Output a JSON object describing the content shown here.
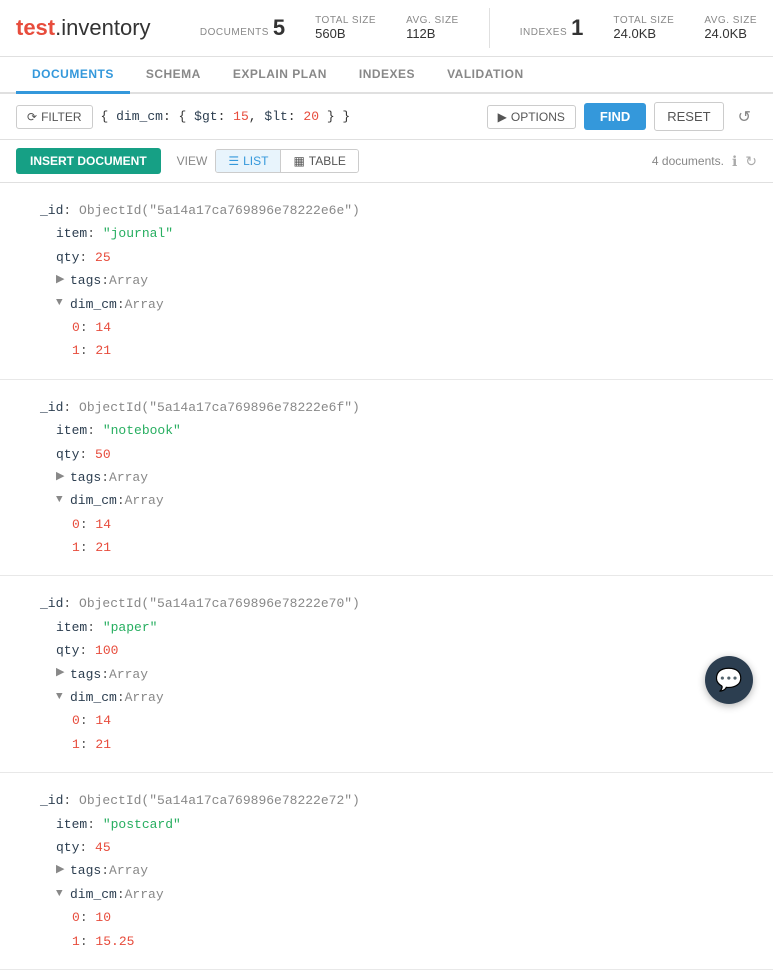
{
  "header": {
    "logo_test": "test",
    "logo_dot": ".",
    "logo_inventory": "inventory",
    "documents_label": "DOCUMENTS",
    "documents_count": "5",
    "total_size_label": "TOTAL SIZE",
    "documents_total_size": "560B",
    "avg_size_label": "AVG. SIZE",
    "documents_avg_size": "112B",
    "indexes_label": "INDEXES",
    "indexes_count": "1",
    "indexes_total_size": "24.0KB",
    "indexes_avg_size": "24.0KB"
  },
  "tabs": [
    {
      "id": "documents",
      "label": "DOCUMENTS",
      "active": true
    },
    {
      "id": "schema",
      "label": "SCHEMA",
      "active": false
    },
    {
      "id": "explain-plan",
      "label": "EXPLAIN PLAN",
      "active": false
    },
    {
      "id": "indexes",
      "label": "INDEXES",
      "active": false
    },
    {
      "id": "validation",
      "label": "VALIDATION",
      "active": false
    }
  ],
  "filter": {
    "button_label": "FILTER",
    "query": "{ dim_cm: { $gt: 15, $lt: 20 } }",
    "options_label": "OPTIONS",
    "find_label": "FIND",
    "reset_label": "RESET"
  },
  "action_bar": {
    "insert_label": "INSERT DOCUMENT",
    "view_label": "VIEW",
    "list_label": "LIST",
    "table_label": "TABLE",
    "doc_count": "4 documents."
  },
  "documents": [
    {
      "id": "5a14a17ca769896e78222e6e",
      "item": "journal",
      "qty": 25,
      "tags": "Array",
      "dim_cm": "Array",
      "dim_cm_0": 14,
      "dim_cm_1": 21
    },
    {
      "id": "5a14a17ca769896e78222e6f",
      "item": "notebook",
      "qty": 50,
      "tags": "Array",
      "dim_cm": "Array",
      "dim_cm_0": 14,
      "dim_cm_1": 21
    },
    {
      "id": "5a14a17ca769896e78222e70",
      "item": "paper",
      "qty": 100,
      "tags": "Array",
      "dim_cm": "Array",
      "dim_cm_0": 14,
      "dim_cm_1": 21
    },
    {
      "id": "5a14a17ca769896e78222e72",
      "item": "postcard",
      "qty": 45,
      "tags": "Array",
      "dim_cm": "Array",
      "dim_cm_0": 10,
      "dim_cm_1_val": "15.25"
    }
  ],
  "chat": {
    "icon": "💬"
  }
}
